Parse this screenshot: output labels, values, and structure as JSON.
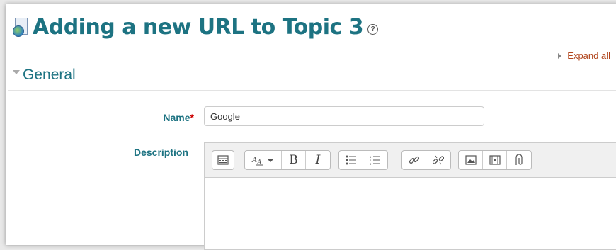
{
  "header": {
    "title": "Adding a new URL to Topic 3"
  },
  "controls": {
    "expand_all_label": "Expand all"
  },
  "section": {
    "title": "General"
  },
  "form": {
    "name_label": "Name",
    "required_mark": "*",
    "name_value": "Google",
    "description_label": "Description"
  },
  "editor_toolbar": {
    "groups": [
      [
        "toolbar-toggle-icon"
      ],
      [
        "font-style-icon",
        "bold-icon",
        "italic-icon"
      ],
      [
        "bulleted-list-icon",
        "numbered-list-icon"
      ],
      [
        "link-icon",
        "unlink-icon"
      ],
      [
        "image-icon",
        "media-icon",
        "manage-files-icon"
      ]
    ]
  }
}
